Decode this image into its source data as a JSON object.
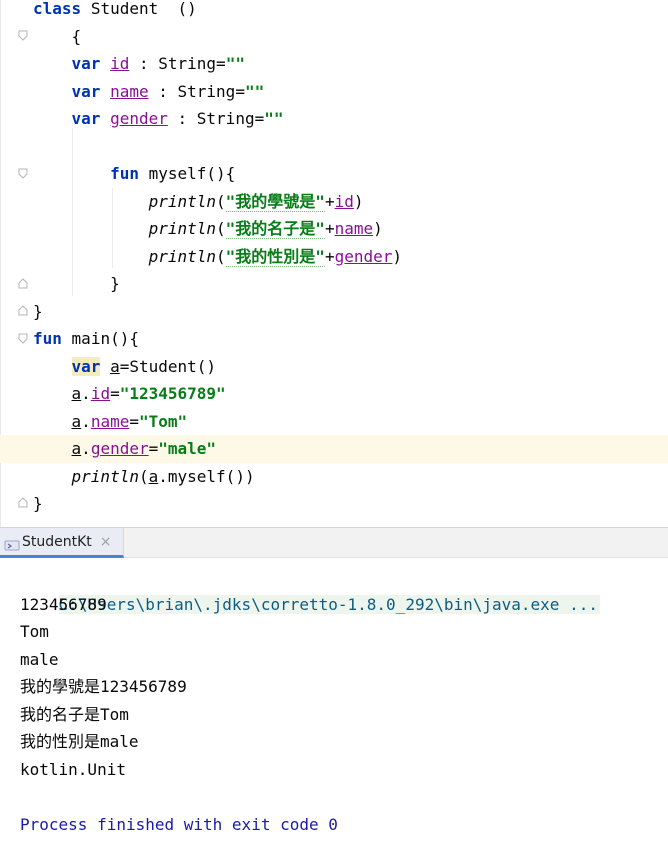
{
  "editor": {
    "class_decl": {
      "kw": "class",
      "name": "Student",
      "params": "()"
    },
    "open_brace": "{",
    "props": [
      {
        "kw": "var",
        "name": "id",
        "sep": " : ",
        "type": "String",
        "eq": "=",
        "value": "\"\""
      },
      {
        "kw": "var",
        "name": "name",
        "sep": " : ",
        "type": "String",
        "eq": "=",
        "value": "\"\""
      },
      {
        "kw": "var",
        "name": "gender",
        "sep": " : ",
        "type": "String",
        "eq": "=",
        "value": "\"\""
      }
    ],
    "fun_myself": {
      "kw": "fun",
      "sig": "myself(){"
    },
    "printlns": [
      {
        "fn": "println",
        "open": "(",
        "str": "\"我的學號是\"",
        "plus": "+",
        "prop": "id",
        "close": ")"
      },
      {
        "fn": "println",
        "open": "(",
        "str": "\"我的名子是\"",
        "plus": "+",
        "prop": "name",
        "close": ")"
      },
      {
        "fn": "println",
        "open": "(",
        "str": "\"我的性別是\"",
        "plus": "+",
        "prop": "gender",
        "close": ")"
      }
    ],
    "fun_close": "}",
    "class_close": "}",
    "main_decl": {
      "kw": "fun",
      "sig": "main(){"
    },
    "main_var": {
      "kw": "var",
      "name": "a",
      "rest": "=Student()"
    },
    "assigns": [
      {
        "obj": "a",
        "dot": ".",
        "prop": "id",
        "eq": "=",
        "value": "\"123456789\""
      },
      {
        "obj": "a",
        "dot": ".",
        "prop": "name",
        "eq": "=",
        "value": "\"Tom\""
      },
      {
        "obj": "a",
        "dot": ".",
        "prop": "gender",
        "eq": "=",
        "value": "\"male\""
      }
    ],
    "main_println": {
      "fn": "println",
      "open": "(",
      "obj": "a",
      "rest": ".myself())"
    },
    "main_close": "}"
  },
  "run": {
    "tab_label": "StudentKt",
    "tab_close": "×",
    "command": "C:\\Users\\brian\\.jdks\\corretto-1.8.0_292\\bin\\java.exe ...",
    "output": [
      "123456789",
      "Tom",
      "male",
      "我的學號是123456789",
      "我的名子是Tom",
      "我的性別是male",
      "kotlin.Unit"
    ],
    "process": "Process finished with exit code 0"
  },
  "icons": [
    "fold-icon",
    "run-config-icon",
    "close-icon"
  ],
  "colors": {
    "keyword": "#0033b3",
    "string": "#067d17",
    "property": "#871094",
    "current_line": "#fdf9e6",
    "console_process": "#1a1aa6"
  }
}
